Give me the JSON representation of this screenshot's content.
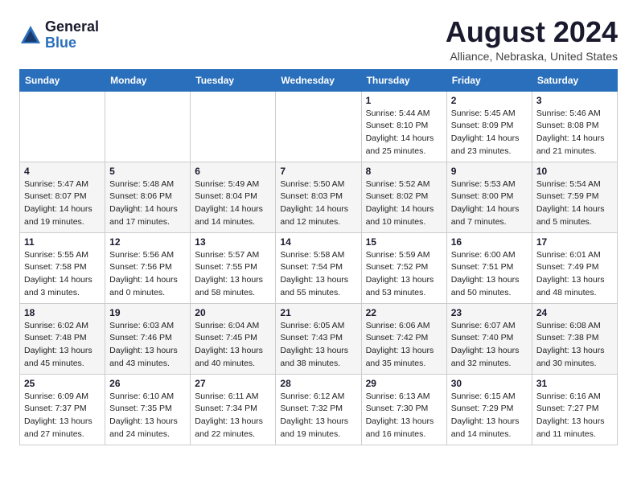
{
  "header": {
    "logo_general": "General",
    "logo_blue": "Blue",
    "month_title": "August 2024",
    "location": "Alliance, Nebraska, United States"
  },
  "weekdays": [
    "Sunday",
    "Monday",
    "Tuesday",
    "Wednesday",
    "Thursday",
    "Friday",
    "Saturday"
  ],
  "weeks": [
    [
      {
        "day": "",
        "info": ""
      },
      {
        "day": "",
        "info": ""
      },
      {
        "day": "",
        "info": ""
      },
      {
        "day": "",
        "info": ""
      },
      {
        "day": "1",
        "info": "Sunrise: 5:44 AM\nSunset: 8:10 PM\nDaylight: 14 hours\nand 25 minutes."
      },
      {
        "day": "2",
        "info": "Sunrise: 5:45 AM\nSunset: 8:09 PM\nDaylight: 14 hours\nand 23 minutes."
      },
      {
        "day": "3",
        "info": "Sunrise: 5:46 AM\nSunset: 8:08 PM\nDaylight: 14 hours\nand 21 minutes."
      }
    ],
    [
      {
        "day": "4",
        "info": "Sunrise: 5:47 AM\nSunset: 8:07 PM\nDaylight: 14 hours\nand 19 minutes."
      },
      {
        "day": "5",
        "info": "Sunrise: 5:48 AM\nSunset: 8:06 PM\nDaylight: 14 hours\nand 17 minutes."
      },
      {
        "day": "6",
        "info": "Sunrise: 5:49 AM\nSunset: 8:04 PM\nDaylight: 14 hours\nand 14 minutes."
      },
      {
        "day": "7",
        "info": "Sunrise: 5:50 AM\nSunset: 8:03 PM\nDaylight: 14 hours\nand 12 minutes."
      },
      {
        "day": "8",
        "info": "Sunrise: 5:52 AM\nSunset: 8:02 PM\nDaylight: 14 hours\nand 10 minutes."
      },
      {
        "day": "9",
        "info": "Sunrise: 5:53 AM\nSunset: 8:00 PM\nDaylight: 14 hours\nand 7 minutes."
      },
      {
        "day": "10",
        "info": "Sunrise: 5:54 AM\nSunset: 7:59 PM\nDaylight: 14 hours\nand 5 minutes."
      }
    ],
    [
      {
        "day": "11",
        "info": "Sunrise: 5:55 AM\nSunset: 7:58 PM\nDaylight: 14 hours\nand 3 minutes."
      },
      {
        "day": "12",
        "info": "Sunrise: 5:56 AM\nSunset: 7:56 PM\nDaylight: 14 hours\nand 0 minutes."
      },
      {
        "day": "13",
        "info": "Sunrise: 5:57 AM\nSunset: 7:55 PM\nDaylight: 13 hours\nand 58 minutes."
      },
      {
        "day": "14",
        "info": "Sunrise: 5:58 AM\nSunset: 7:54 PM\nDaylight: 13 hours\nand 55 minutes."
      },
      {
        "day": "15",
        "info": "Sunrise: 5:59 AM\nSunset: 7:52 PM\nDaylight: 13 hours\nand 53 minutes."
      },
      {
        "day": "16",
        "info": "Sunrise: 6:00 AM\nSunset: 7:51 PM\nDaylight: 13 hours\nand 50 minutes."
      },
      {
        "day": "17",
        "info": "Sunrise: 6:01 AM\nSunset: 7:49 PM\nDaylight: 13 hours\nand 48 minutes."
      }
    ],
    [
      {
        "day": "18",
        "info": "Sunrise: 6:02 AM\nSunset: 7:48 PM\nDaylight: 13 hours\nand 45 minutes."
      },
      {
        "day": "19",
        "info": "Sunrise: 6:03 AM\nSunset: 7:46 PM\nDaylight: 13 hours\nand 43 minutes."
      },
      {
        "day": "20",
        "info": "Sunrise: 6:04 AM\nSunset: 7:45 PM\nDaylight: 13 hours\nand 40 minutes."
      },
      {
        "day": "21",
        "info": "Sunrise: 6:05 AM\nSunset: 7:43 PM\nDaylight: 13 hours\nand 38 minutes."
      },
      {
        "day": "22",
        "info": "Sunrise: 6:06 AM\nSunset: 7:42 PM\nDaylight: 13 hours\nand 35 minutes."
      },
      {
        "day": "23",
        "info": "Sunrise: 6:07 AM\nSunset: 7:40 PM\nDaylight: 13 hours\nand 32 minutes."
      },
      {
        "day": "24",
        "info": "Sunrise: 6:08 AM\nSunset: 7:38 PM\nDaylight: 13 hours\nand 30 minutes."
      }
    ],
    [
      {
        "day": "25",
        "info": "Sunrise: 6:09 AM\nSunset: 7:37 PM\nDaylight: 13 hours\nand 27 minutes."
      },
      {
        "day": "26",
        "info": "Sunrise: 6:10 AM\nSunset: 7:35 PM\nDaylight: 13 hours\nand 24 minutes."
      },
      {
        "day": "27",
        "info": "Sunrise: 6:11 AM\nSunset: 7:34 PM\nDaylight: 13 hours\nand 22 minutes."
      },
      {
        "day": "28",
        "info": "Sunrise: 6:12 AM\nSunset: 7:32 PM\nDaylight: 13 hours\nand 19 minutes."
      },
      {
        "day": "29",
        "info": "Sunrise: 6:13 AM\nSunset: 7:30 PM\nDaylight: 13 hours\nand 16 minutes."
      },
      {
        "day": "30",
        "info": "Sunrise: 6:15 AM\nSunset: 7:29 PM\nDaylight: 13 hours\nand 14 minutes."
      },
      {
        "day": "31",
        "info": "Sunrise: 6:16 AM\nSunset: 7:27 PM\nDaylight: 13 hours\nand 11 minutes."
      }
    ]
  ]
}
